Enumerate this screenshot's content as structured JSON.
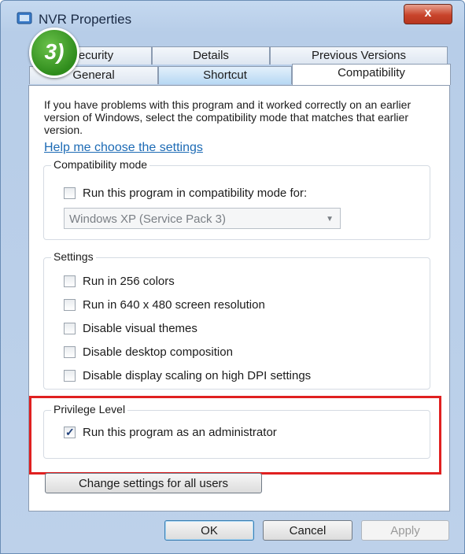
{
  "window": {
    "title": "NVR Properties",
    "close_label": "x",
    "step_badge": "3)"
  },
  "tabs": {
    "row1": [
      {
        "label": "Security"
      },
      {
        "label": "Details"
      },
      {
        "label": "Previous Versions"
      }
    ],
    "row2": [
      {
        "label": "General"
      },
      {
        "label": "Shortcut"
      },
      {
        "label": "Compatibility"
      }
    ]
  },
  "content": {
    "intro": "If you have problems with this program and it worked correctly on an earlier version of Windows, select the compatibility mode that matches that earlier version.",
    "help_link": "Help me choose the settings",
    "compat_mode": {
      "label": "Compatibility mode",
      "checkbox_label": "Run this program in compatibility mode for:",
      "checked": false,
      "selected_os": "Windows XP (Service Pack 3)"
    },
    "settings": {
      "label": "Settings",
      "items": [
        {
          "label": "Run in 256 colors",
          "checked": false
        },
        {
          "label": "Run in 640 x 480 screen resolution",
          "checked": false
        },
        {
          "label": "Disable visual themes",
          "checked": false
        },
        {
          "label": "Disable desktop composition",
          "checked": false
        },
        {
          "label": "Disable display scaling on high DPI settings",
          "checked": false
        }
      ]
    },
    "privilege": {
      "label": "Privilege Level",
      "checkbox_label": "Run this program as an administrator",
      "checked": true
    },
    "change_all_users": "Change settings for all users"
  },
  "footer": {
    "ok": "OK",
    "cancel": "Cancel",
    "apply": "Apply"
  },
  "colors": {
    "highlight_box": "#e02020",
    "link": "#1d6bb5",
    "step_badge": "#2f8c1c"
  }
}
